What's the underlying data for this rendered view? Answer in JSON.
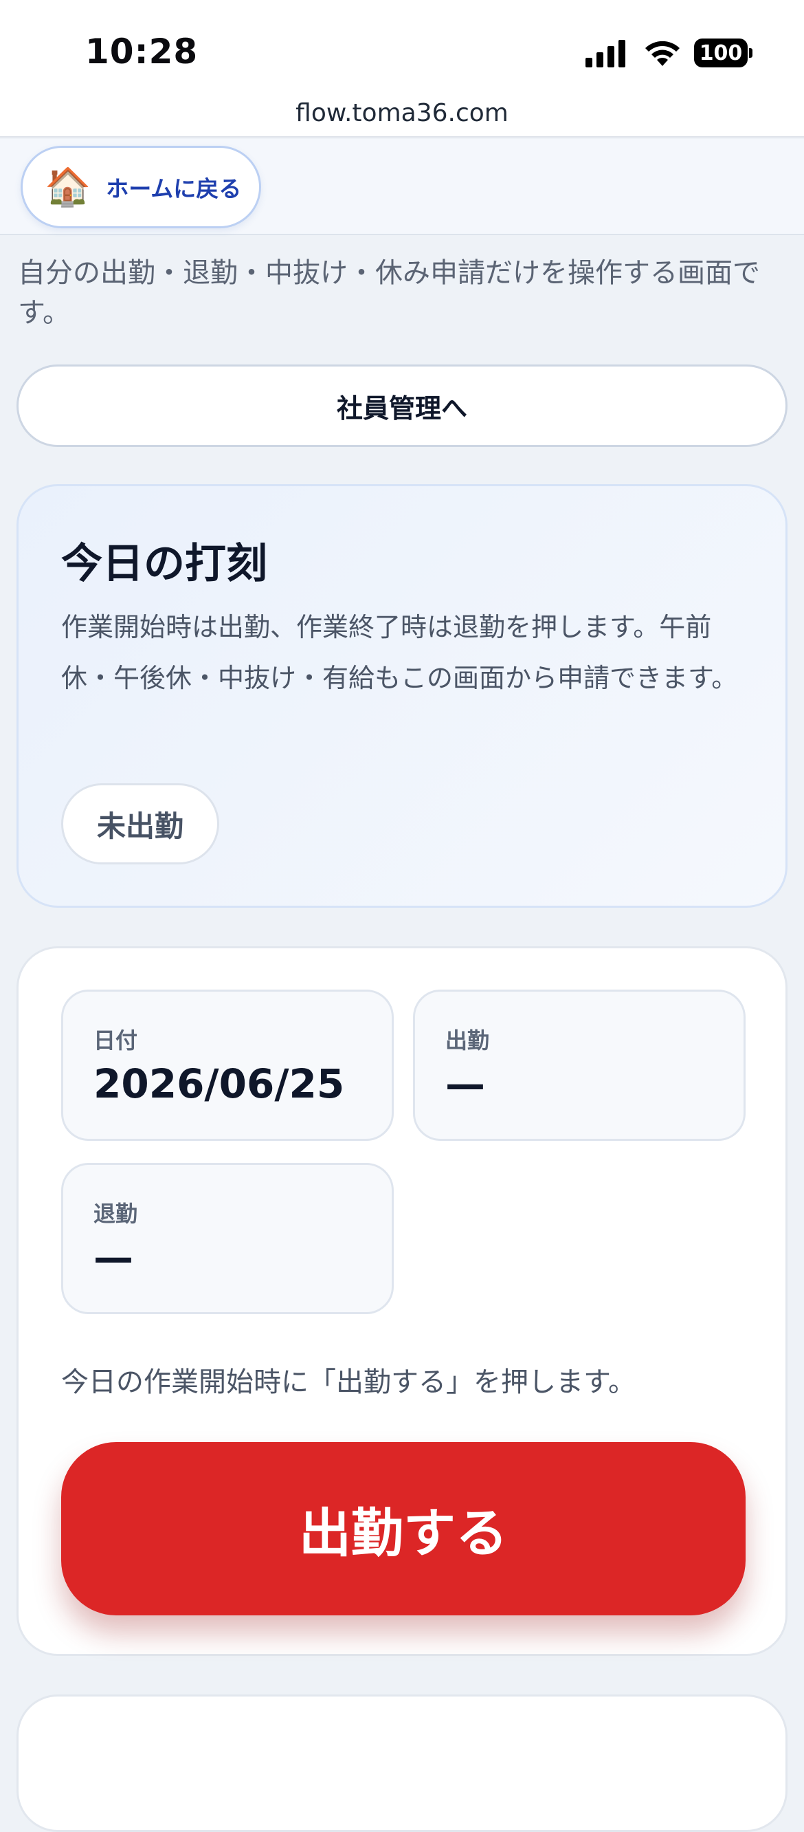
{
  "status_bar": {
    "time": "10:28",
    "battery": "100"
  },
  "browser": {
    "url": "flow.toma36.com"
  },
  "nav": {
    "home_icon": "🏠",
    "home_label": "ホームに戻る"
  },
  "page": {
    "description": "自分の出勤・退勤・中抜け・休み申請だけを操作する画面です。",
    "employee_mgmt_label": "社員管理へ"
  },
  "today": {
    "title": "今日の打刻",
    "description": "作業開始時は出勤、作業終了時は退勤を押します。午前休・午後休・中抜け・有給もこの画面から申請できます。",
    "status": "未出勤"
  },
  "punch": {
    "date_label": "日付",
    "date_value": "2026/06/25",
    "clock_in_label": "出勤",
    "clock_in_value": "—",
    "clock_out_label": "退勤",
    "clock_out_value": "—",
    "hint": "今日の作業開始時に「出勤する」を押します。",
    "clock_in_button": "出勤する"
  },
  "colors": {
    "accent_red": "#dc2626",
    "link_blue": "#1e3fae"
  }
}
